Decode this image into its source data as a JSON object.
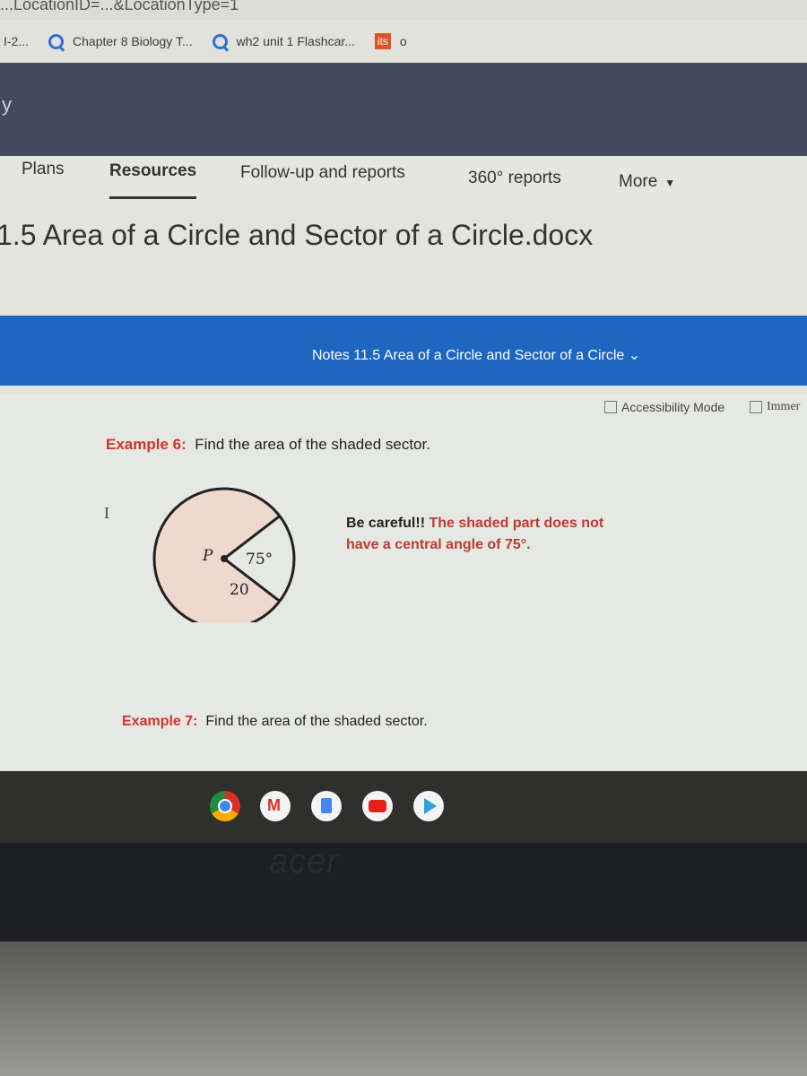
{
  "browser": {
    "url_fragment": "...LocationID=...&LocationType=1",
    "bookmarks": [
      {
        "label": "I-2...",
        "icon": "none"
      },
      {
        "label": "Chapter 8 Biology T...",
        "icon": "quizlet-icon"
      },
      {
        "label": "wh2 unit 1 Flashcar...",
        "icon": "quizlet-icon"
      },
      {
        "label": "o",
        "icon": "its-icon",
        "badge": "its"
      }
    ]
  },
  "app": {
    "header_partial_text": "y",
    "nav": [
      {
        "label": "Plans",
        "active": false
      },
      {
        "label": "Resources",
        "active": true
      },
      {
        "label": "Follow-up and reports",
        "active": false
      },
      {
        "label": "360° reports",
        "active": false
      },
      {
        "label": "More",
        "active": false
      }
    ],
    "doc_title": "1.5 Area of a Circle and Sector of a Circle.docx"
  },
  "word": {
    "doc_name": "Notes 11.5 Area of a Circle and Sector of a Circle",
    "accessibility_mode": "Accessibility Mode",
    "immersive_reader": "Immer"
  },
  "document": {
    "example6": {
      "label": "Example 6:",
      "text": "Find the area of the shaded sector."
    },
    "figure": {
      "center_label": "P",
      "angle_label": "75°",
      "radius_label": "20"
    },
    "note": {
      "lead": "Be careful!!",
      "text": "The shaded part does not have a central angle of 75°."
    },
    "example7": {
      "label": "Example 7:",
      "text": "Find the area of the shaded sector."
    }
  },
  "shelf": {
    "apps": [
      "chrome-icon",
      "gmail-icon",
      "docs-icon",
      "youtube-icon",
      "play-store-icon"
    ]
  },
  "hardware": {
    "brand": "acer"
  },
  "colors": {
    "header": "#444a5e",
    "word_bar": "#1f66c1",
    "example_label": "#d0342c",
    "shaded_sector": "#efd9cf"
  }
}
